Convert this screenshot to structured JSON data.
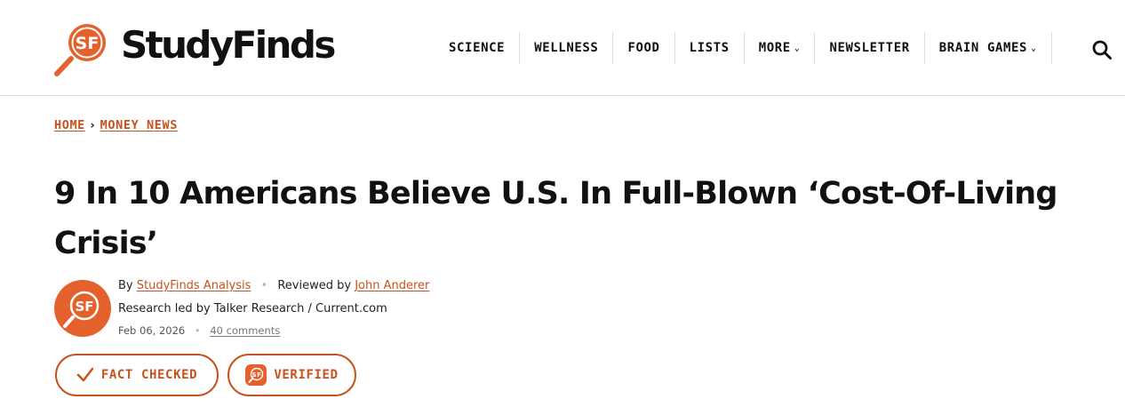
{
  "brand": {
    "name": "StudyFinds",
    "mark_text": "SF",
    "accent_color": "#e4612b"
  },
  "nav": {
    "items": [
      {
        "label": "SCIENCE",
        "dropdown": false
      },
      {
        "label": "WELLNESS",
        "dropdown": false
      },
      {
        "label": "FOOD",
        "dropdown": false
      },
      {
        "label": "LISTS",
        "dropdown": false
      },
      {
        "label": "MORE",
        "dropdown": true
      },
      {
        "label": "NEWSLETTER",
        "dropdown": false
      },
      {
        "label": "BRAIN GAMES",
        "dropdown": true
      }
    ],
    "search_icon": "search-icon"
  },
  "breadcrumb": {
    "home": "HOME",
    "separator": "›",
    "section": "MONEY NEWS"
  },
  "article": {
    "title": "9 In 10 Americans Believe U.S. In Full-Blown ‘Cost-Of-Living Crisis’",
    "by_prefix": "By",
    "author": "StudyFinds Analysis",
    "reviewed_prefix": "Reviewed by",
    "reviewer": "John Anderer",
    "research_credit": "Research led by Talker Research / Current.com",
    "date": "Feb 06, 2026",
    "comments": "40 comments"
  },
  "badges": {
    "fact_checked": "FACT CHECKED",
    "verified": "VERIFIED"
  }
}
